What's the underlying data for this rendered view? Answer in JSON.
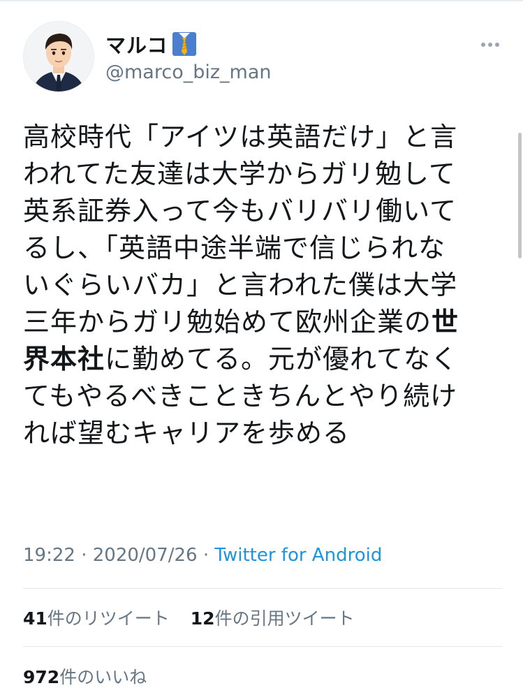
{
  "author": {
    "display_name": "マルコ",
    "handle": "@marco_biz_man"
  },
  "tweet": {
    "text_part1": "高校時代「アイツは英語だけ」と言\nわれてた友達は大学からガリ勉して\n英系証券入って今もバリバリ働いて\nるし、「英語中途半端で信じられな\nいぐらいバカ」と言われた僕は大学\n三年からガリ勉始めて欧州企業の",
    "text_bold": "世\n界本社",
    "text_part2": "に勤めてる。元が優れてなく\nてもやるべきこときちんとやり続け\nれば望むキャリアを歩める",
    "time": "19:22",
    "separator": "·",
    "date": "2020/07/26",
    "source": "Twitter for Android"
  },
  "stats": {
    "retweets_count": "41",
    "retweets_label": "件のリツイート",
    "quotes_count": "12",
    "quotes_label": "件の引用ツイート",
    "likes_count": "972",
    "likes_label": "件のいいね"
  },
  "icons": {
    "badge": "necktie-icon",
    "menu": "more-dots-icon"
  },
  "colors": {
    "link": "#1b95e0",
    "secondary_text": "#657786"
  }
}
